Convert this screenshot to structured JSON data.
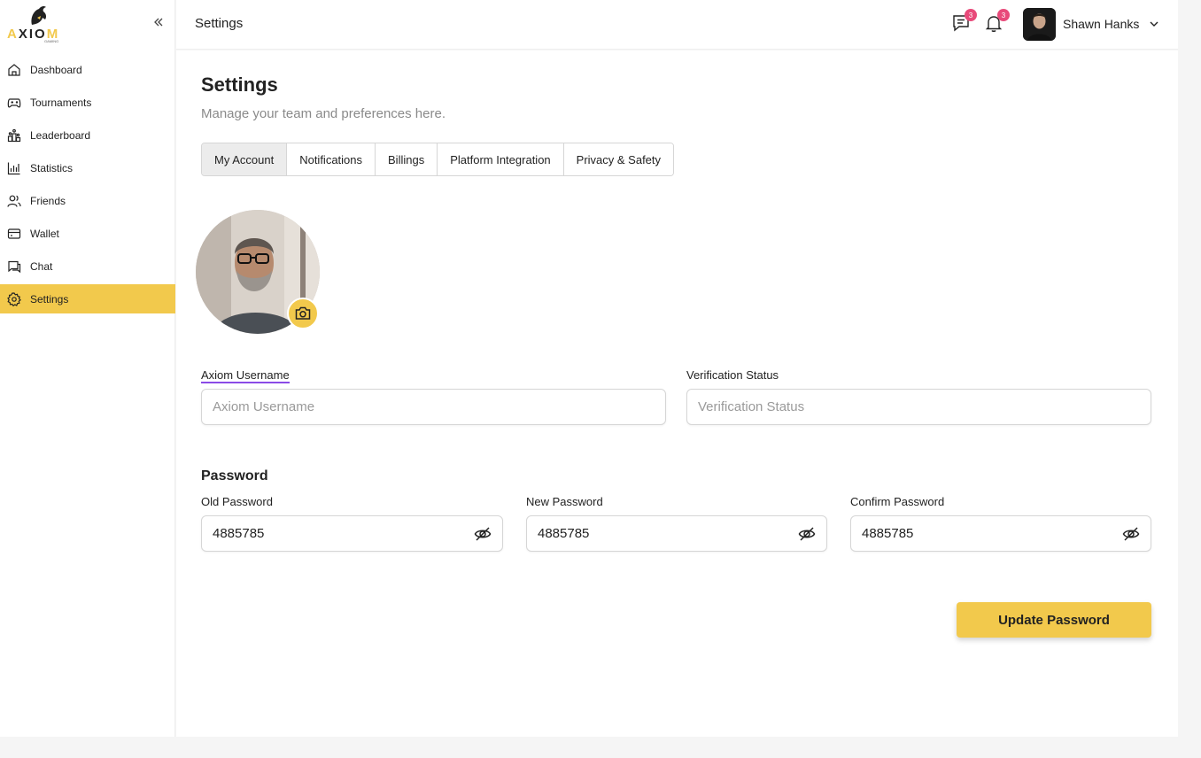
{
  "brand": {
    "name_a": "A",
    "name_mid": "XIO",
    "name_b": "M",
    "tagline": "GAMING"
  },
  "sidebar": {
    "items": [
      {
        "label": "Dashboard",
        "icon": "home-icon"
      },
      {
        "label": "Tournaments",
        "icon": "gamepad-icon"
      },
      {
        "label": "Leaderboard",
        "icon": "podium-icon"
      },
      {
        "label": "Statistics",
        "icon": "bar-chart-icon"
      },
      {
        "label": "Friends",
        "icon": "users-icon"
      },
      {
        "label": "Wallet",
        "icon": "wallet-icon"
      },
      {
        "label": "Chat",
        "icon": "chat-icon"
      },
      {
        "label": "Settings",
        "icon": "gear-icon",
        "active": true
      }
    ]
  },
  "header": {
    "title": "Settings",
    "messages_count": "3",
    "notifications_count": "3",
    "user_name": "Shawn Hanks"
  },
  "main": {
    "title": "Settings",
    "subtitle": "Manage your team and preferences here.",
    "tabs": [
      {
        "label": "My Account",
        "active": true
      },
      {
        "label": "Notifications"
      },
      {
        "label": "Billings"
      },
      {
        "label": "Platform Integration"
      },
      {
        "label": "Privacy & Safety"
      }
    ],
    "username": {
      "label": "Axiom Username",
      "placeholder": "Axiom Username",
      "value": ""
    },
    "verification": {
      "label": "Verification Status",
      "placeholder": "Verification Status",
      "value": ""
    },
    "password_section": "Password",
    "old_password": {
      "label": "Old Password",
      "value": "4885785"
    },
    "new_password": {
      "label": "New Password",
      "value": "4885785"
    },
    "confirm_password": {
      "label": "Confirm Password",
      "value": "4885785"
    },
    "update_button": "Update Password"
  },
  "colors": {
    "accent": "#f2c94c",
    "badge": "#e84a7a",
    "focus_underline": "#8a4ae6"
  }
}
